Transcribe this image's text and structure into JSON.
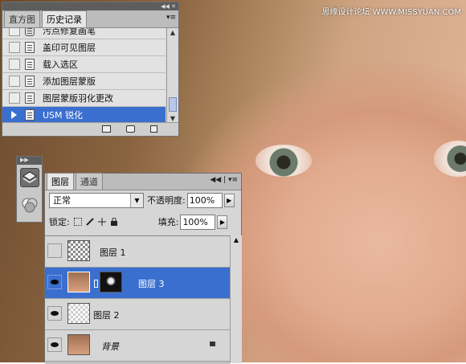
{
  "watermark": "思缘设计论坛 WWW.MISSYUAN.COM",
  "history_panel": {
    "tabs": [
      {
        "label": "直方图"
      },
      {
        "label": "历史记录"
      }
    ],
    "menu_icon": "panel-menu-icon",
    "items": [
      {
        "label": "污点修复画笔",
        "icon": "healing-brush-icon"
      },
      {
        "label": "盖印可见图层",
        "icon": "document-icon"
      },
      {
        "label": "载入选区",
        "icon": "document-icon"
      },
      {
        "label": "添加图层蒙版",
        "icon": "document-icon"
      },
      {
        "label": "图层蒙版羽化更改",
        "icon": "document-icon"
      },
      {
        "label": "USM 锐化",
        "icon": "document-icon",
        "selected": true
      }
    ],
    "footer_icons": [
      "new-document-icon",
      "snapshot-icon",
      "trash-icon"
    ]
  },
  "layers_panel": {
    "tabs": [
      {
        "label": "图层"
      },
      {
        "label": "通道"
      }
    ],
    "blend_mode": "正常",
    "opacity_label": "不透明度:",
    "opacity_value": "100%",
    "lock_label": "锁定:",
    "fill_label": "填充:",
    "fill_value": "100%",
    "layers": [
      {
        "name": "图层 1",
        "visible": false,
        "selected": false
      },
      {
        "name": "图层 3",
        "visible": true,
        "selected": true,
        "has_mask": true
      },
      {
        "name": "图层 2",
        "visible": true,
        "selected": false
      },
      {
        "name": "背景",
        "visible": true,
        "selected": false,
        "locked": true
      }
    ]
  },
  "colors": {
    "selection": "#3a6fcf",
    "panel": "#d6d6d6"
  }
}
